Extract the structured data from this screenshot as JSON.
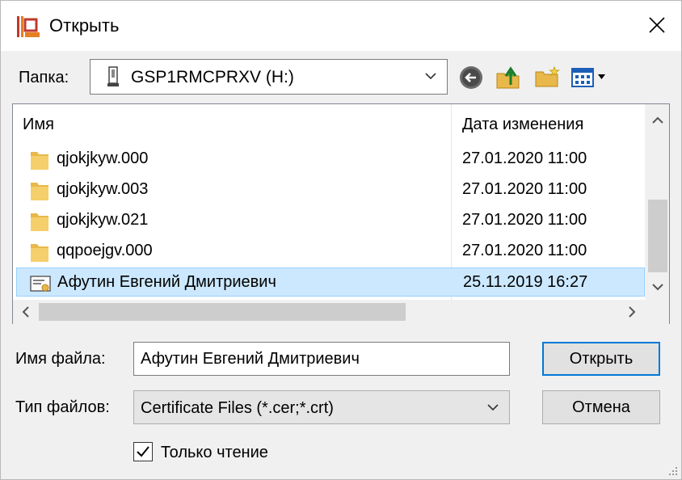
{
  "window": {
    "title": "Открыть"
  },
  "toolbar": {
    "folder_label": "Папка:",
    "folder_value": "GSP1RMCPRXV (H:)",
    "icons": [
      "back-icon",
      "up-folder-icon",
      "new-folder-icon",
      "view-menu-icon"
    ]
  },
  "list": {
    "col_name": "Имя",
    "col_date": "Дата изменения",
    "rows": [
      {
        "name": "qjokjkyw.000",
        "date": "27.01.2020 11:00",
        "icon": "folder-icon"
      },
      {
        "name": "qjokjkyw.003",
        "date": "27.01.2020 11:00",
        "icon": "folder-icon"
      },
      {
        "name": "qjokjkyw.021",
        "date": "27.01.2020 11:00",
        "icon": "folder-icon"
      },
      {
        "name": "qqpoejgv.000",
        "date": "27.01.2020 11:00",
        "icon": "folder-icon"
      },
      {
        "name": "Афутин Евгений Дмитриевич",
        "date": "25.11.2019 16:27",
        "icon": "certificate-icon",
        "selected": true
      }
    ]
  },
  "form": {
    "filename_label": "Имя файла:",
    "filename_value": "Афутин Евгений Дмитриевич",
    "filetype_label": "Тип файлов:",
    "filetype_value": "Certificate Files (*.cer;*.crt)",
    "readonly_label": "Только чтение",
    "readonly_checked": true
  },
  "buttons": {
    "open": "Открыть",
    "cancel": "Отмена"
  },
  "colors": {
    "selection": "#cce8ff",
    "selection_border": "#99d1ff",
    "accent": "#0078d7",
    "folder": "#e8b84a"
  }
}
